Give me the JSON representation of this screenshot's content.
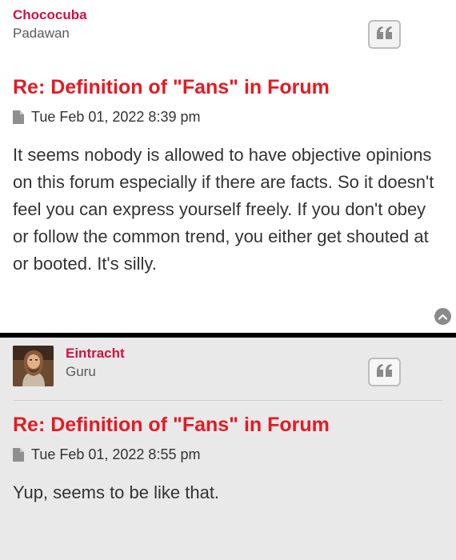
{
  "posts": [
    {
      "author": "Chococuba",
      "rank": "Padawan",
      "title": "Re: Definition of \"Fans\" in Forum",
      "timestamp": "Tue Feb 01, 2022 8:39 pm",
      "body": "It seems nobody is allowed to have objective opinions on this forum especially if there are facts. So it doesn't feel you can express yourself freely. If you don't obey or follow the common trend, you either get shouted at or booted. It's silly."
    },
    {
      "author": "Eintracht",
      "rank": "Guru",
      "title": "Re: Definition of \"Fans\" in Forum",
      "timestamp": "Tue Feb 01, 2022 8:55 pm",
      "body": "Yup, seems to be like that."
    }
  ],
  "icons": {
    "quote": "quote-icon",
    "file": "file-icon",
    "back_to_top": "chevron-up-icon",
    "avatar": "user-avatar"
  },
  "colors": {
    "username": "#d31141",
    "title": "#e31b23",
    "alt_background": "#e9e9e9"
  }
}
